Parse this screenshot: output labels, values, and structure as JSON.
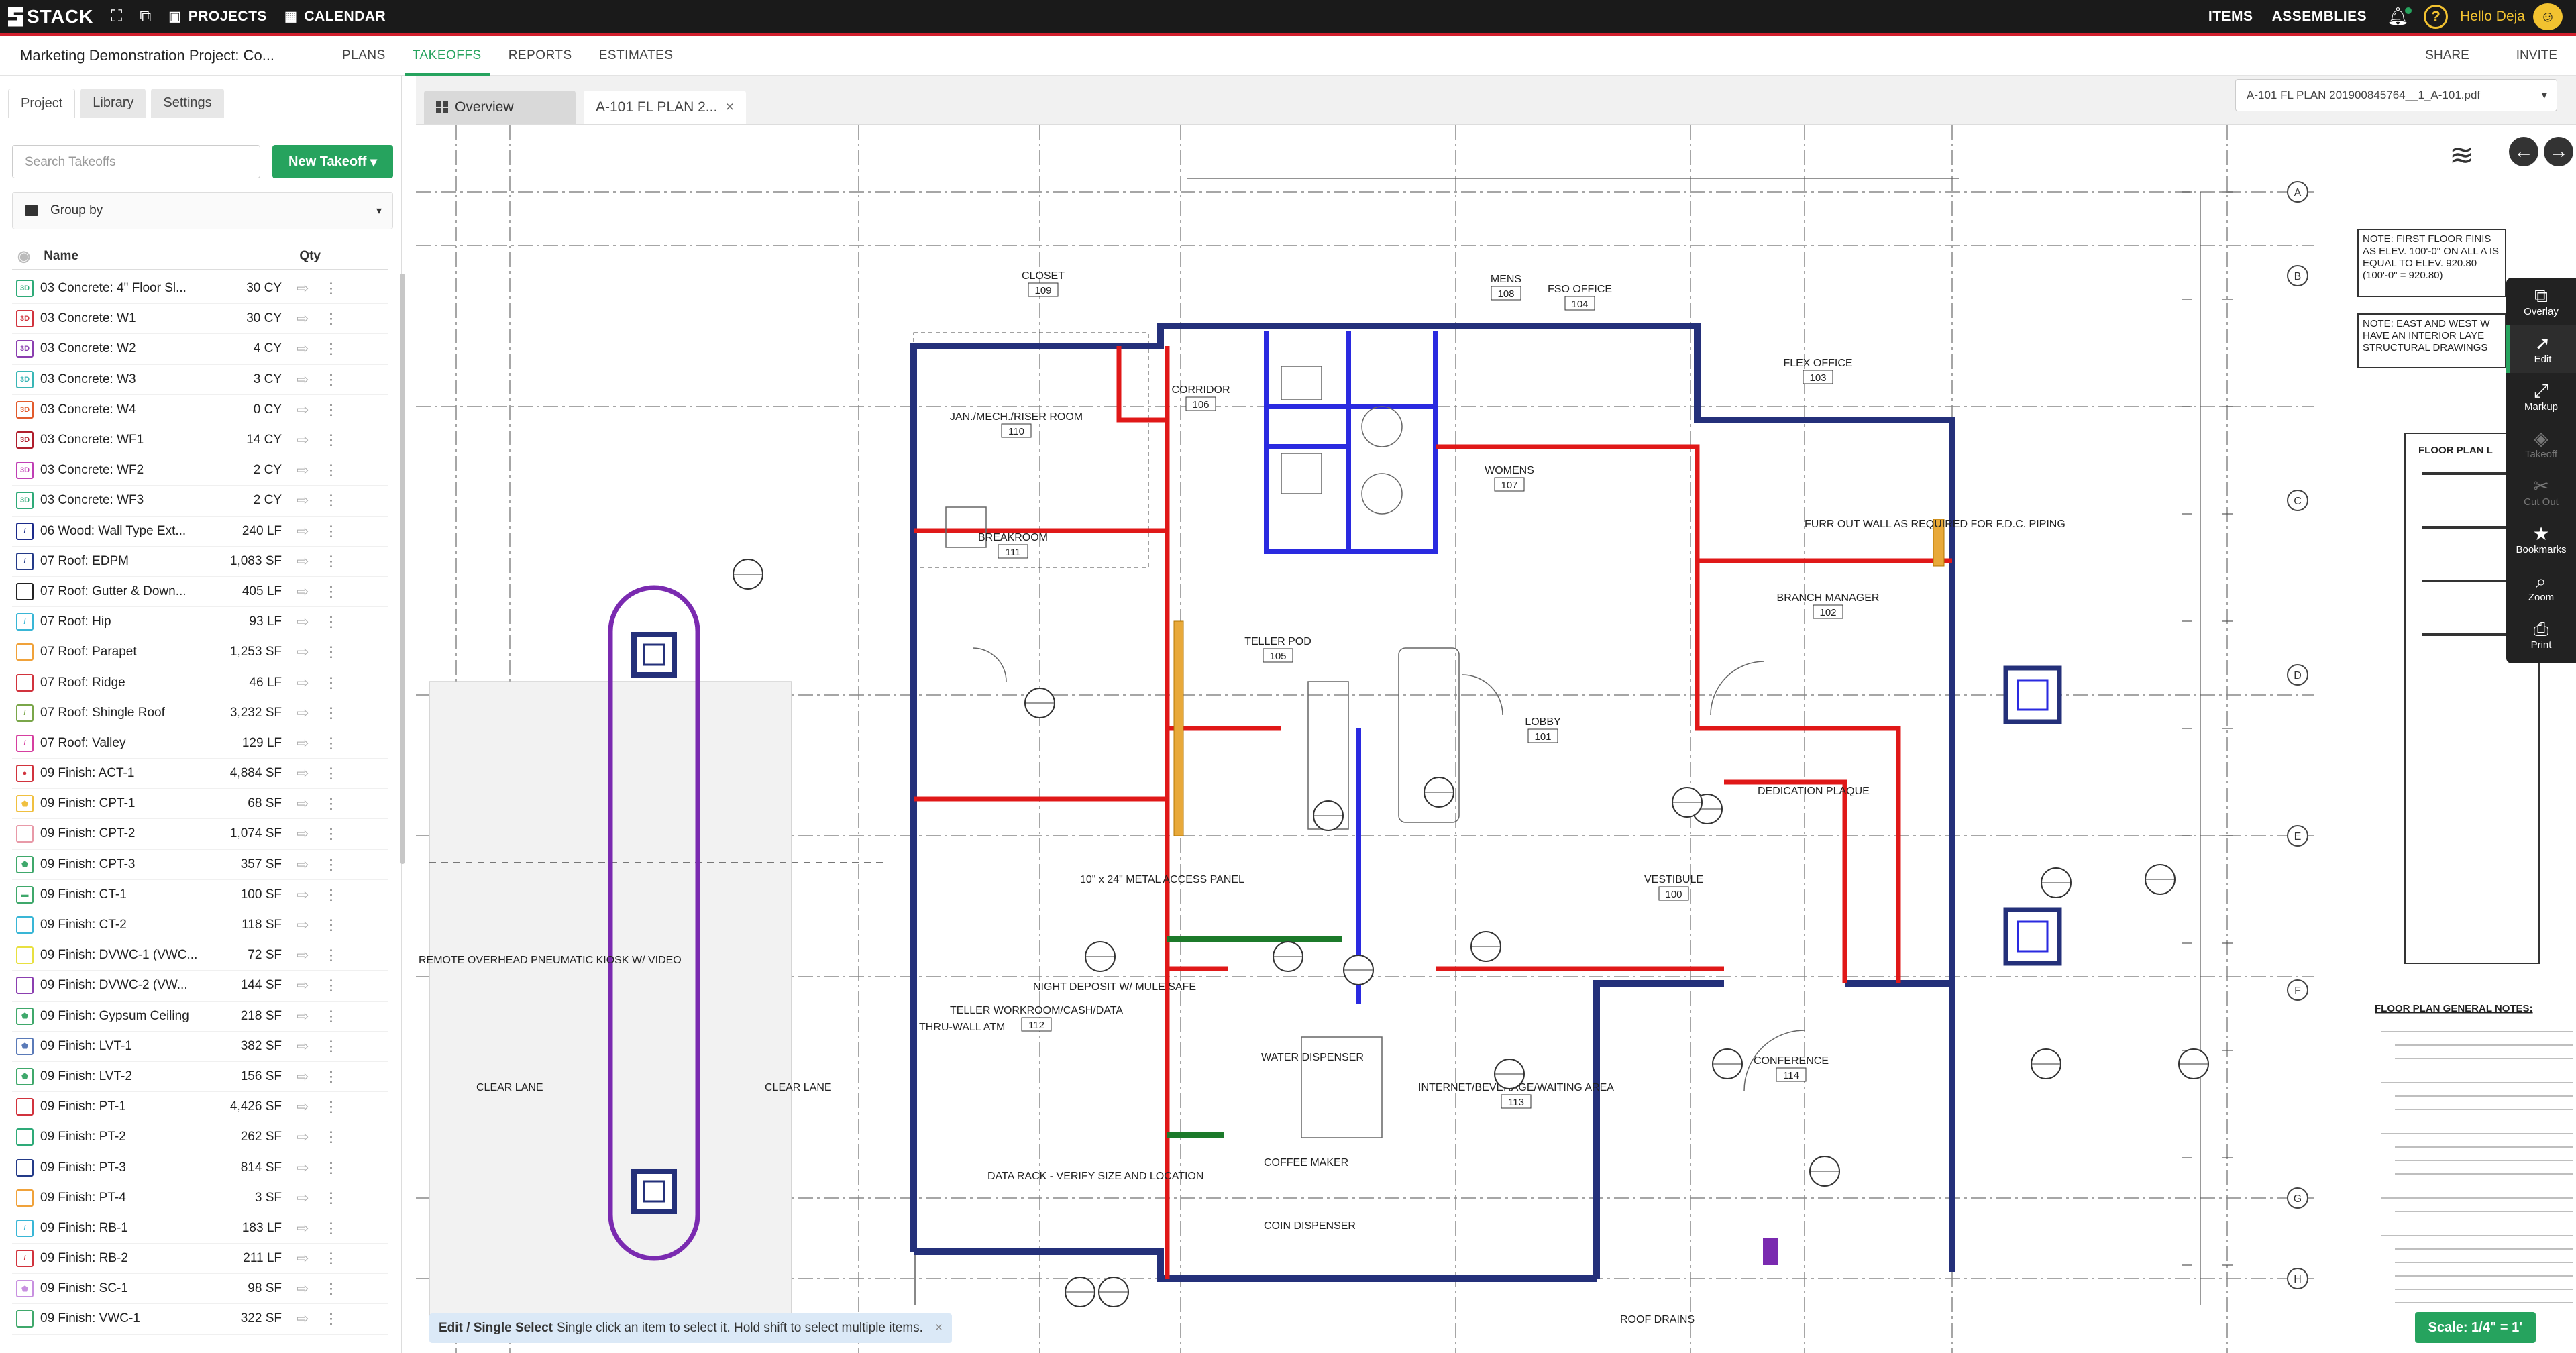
{
  "app": {
    "logo_text": "STACK",
    "nav_projects": "PROJECTS",
    "nav_calendar": "CALENDAR",
    "nav_items": "ITEMS",
    "nav_assemblies": "ASSEMBLIES",
    "greeting": "Hello Deja"
  },
  "subnav": {
    "project_title": "Marketing Demonstration Project: Co...",
    "tabs": [
      "PLANS",
      "TAKEOFFS",
      "REPORTS",
      "ESTIMATES"
    ],
    "active_tab": "TAKEOFFS",
    "share": "SHARE",
    "invite": "INVITE"
  },
  "sidebar": {
    "tabs": [
      "Project",
      "Library",
      "Settings"
    ],
    "search_placeholder": "Search Takeoffs",
    "new_takeoff": "New Takeoff",
    "group_by": "Group by",
    "col_name": "Name",
    "col_qty": "Qty",
    "takeoffs": [
      {
        "name": "03 Concrete: 4\" Floor Sl...",
        "qty": "30 CY",
        "color": "#2eaa78",
        "glyph": "3D"
      },
      {
        "name": "03 Concrete: W1",
        "qty": "30 CY",
        "color": "#d1333d",
        "glyph": "3D"
      },
      {
        "name": "03 Concrete: W2",
        "qty": "4 CY",
        "color": "#8b3fb0",
        "glyph": "3D"
      },
      {
        "name": "03 Concrete: W3",
        "qty": "3 CY",
        "color": "#39b6b6",
        "glyph": "3D"
      },
      {
        "name": "03 Concrete: W4",
        "qty": "0 CY",
        "color": "#e25b2c",
        "glyph": "3D"
      },
      {
        "name": "03 Concrete: WF1",
        "qty": "14 CY",
        "color": "#b01e2c",
        "glyph": "3D"
      },
      {
        "name": "03 Concrete: WF2",
        "qty": "2 CY",
        "color": "#c03fb5",
        "glyph": "3D"
      },
      {
        "name": "03 Concrete: WF3",
        "qty": "2 CY",
        "color": "#2eaa78",
        "glyph": "3D"
      },
      {
        "name": "06 Wood: Wall Type Ext...",
        "qty": "240 LF",
        "color": "#1b2a8a",
        "glyph": "/"
      },
      {
        "name": "07 Roof: EDPM",
        "qty": "1,083 SF",
        "color": "#233a88",
        "glyph": "/"
      },
      {
        "name": "07 Roof: Gutter & Down...",
        "qty": "405 LF",
        "color": "#222222",
        "glyph": ""
      },
      {
        "name": "07 Roof: Hip",
        "qty": "93 LF",
        "color": "#39b6d6",
        "glyph": "/"
      },
      {
        "name": "07 Roof: Parapet",
        "qty": "1,253 SF",
        "color": "#f0a23a",
        "glyph": ""
      },
      {
        "name": "07 Roof: Ridge",
        "qty": "46 LF",
        "color": "#d1333d",
        "glyph": ""
      },
      {
        "name": "07 Roof: Shingle Roof",
        "qty": "3,232 SF",
        "color": "#7aa64a",
        "glyph": "/"
      },
      {
        "name": "07 Roof: Valley",
        "qty": "129 LF",
        "color": "#d63fa0",
        "glyph": "/"
      },
      {
        "name": "09 Finish: ACT-1",
        "qty": "4,884 SF",
        "color": "#d1333d",
        "glyph": "●"
      },
      {
        "name": "09 Finish: CPT-1",
        "qty": "68 SF",
        "color": "#f0c040",
        "glyph": "⬟"
      },
      {
        "name": "09 Finish: CPT-2",
        "qty": "1,074 SF",
        "color": "#e89aa8",
        "glyph": ""
      },
      {
        "name": "09 Finish: CPT-3",
        "qty": "357 SF",
        "color": "#3fa86b",
        "glyph": "⬟"
      },
      {
        "name": "09 Finish: CT-1",
        "qty": "100 SF",
        "color": "#3fa86b",
        "glyph": "▬"
      },
      {
        "name": "09 Finish: CT-2",
        "qty": "118 SF",
        "color": "#39b6d6",
        "glyph": ""
      },
      {
        "name": "09 Finish: DVWC-1 (VWC...",
        "qty": "72 SF",
        "color": "#e8e040",
        "glyph": ""
      },
      {
        "name": "09 Finish: DVWC-2 (VW...",
        "qty": "144 SF",
        "color": "#8b3fb0",
        "glyph": ""
      },
      {
        "name": "09 Finish: Gypsum Ceiling",
        "qty": "218 SF",
        "color": "#3fa86b",
        "glyph": "⬟"
      },
      {
        "name": "09 Finish: LVT-1",
        "qty": "382 SF",
        "color": "#5a7ab8",
        "glyph": "⬟"
      },
      {
        "name": "09 Finish: LVT-2",
        "qty": "156 SF",
        "color": "#3fa86b",
        "glyph": "⬟"
      },
      {
        "name": "09 Finish: PT-1",
        "qty": "4,426 SF",
        "color": "#d1333d",
        "glyph": ""
      },
      {
        "name": "09 Finish: PT-2",
        "qty": "262 SF",
        "color": "#2eaa78",
        "glyph": ""
      },
      {
        "name": "09 Finish: PT-3",
        "qty": "814 SF",
        "color": "#233a88",
        "glyph": ""
      },
      {
        "name": "09 Finish: PT-4",
        "qty": "3 SF",
        "color": "#f0a23a",
        "glyph": ""
      },
      {
        "name": "09 Finish: RB-1",
        "qty": "183 LF",
        "color": "#39b6d6",
        "glyph": "/"
      },
      {
        "name": "09 Finish: RB-2",
        "qty": "211 LF",
        "color": "#d1333d",
        "glyph": "/"
      },
      {
        "name": "09 Finish: SC-1",
        "qty": "98 SF",
        "color": "#c890e0",
        "glyph": "⬟"
      },
      {
        "name": "09 Finish: VWC-1",
        "qty": "322 SF",
        "color": "#3fa86b",
        "glyph": ""
      }
    ]
  },
  "viewer": {
    "tab_overview": "Overview",
    "tab_sheet": "A-101 FL PLAN 2...",
    "sheet_select": "A-101 FL PLAN 201900845764__1_A-101.pdf",
    "status_mode": "Edit / Single Select",
    "status_hint": "Single click an item to select it. Hold shift to select multiple items.",
    "scale": "Scale: 1/4\" = 1'",
    "tools": [
      {
        "label": "Overlay",
        "icon": "overlay-icon",
        "glyph": "⧉",
        "enabled": true
      },
      {
        "label": "Edit",
        "icon": "cursor-icon",
        "glyph": "➚",
        "enabled": true
      },
      {
        "label": "Markup",
        "icon": "markup-icon",
        "glyph": "⤢",
        "enabled": true
      },
      {
        "label": "Takeoff",
        "icon": "takeoff-icon",
        "glyph": "◈",
        "enabled": false
      },
      {
        "label": "Cut Out",
        "icon": "cutout-icon",
        "glyph": "✂",
        "enabled": false
      },
      {
        "label": "Bookmarks",
        "icon": "star-icon",
        "glyph": "★",
        "enabled": true
      },
      {
        "label": "Zoom",
        "icon": "zoom-icon",
        "glyph": "⌕",
        "enabled": true
      },
      {
        "label": "Print",
        "icon": "print-icon",
        "glyph": "⎙",
        "enabled": true
      }
    ]
  },
  "plan": {
    "grid_right": [
      "A",
      "B",
      "C",
      "D",
      "E",
      "F",
      "G",
      "H"
    ],
    "rooms": [
      {
        "name": "CLOSET",
        "num": "109"
      },
      {
        "name": "CORRIDOR",
        "num": "106"
      },
      {
        "name": "JAN./MECH./RISER ROOM",
        "num": "110"
      },
      {
        "name": "MENS",
        "num": "108"
      },
      {
        "name": "FSO OFFICE",
        "num": "104"
      },
      {
        "name": "FLEX OFFICE",
        "num": "103"
      },
      {
        "name": "WOMENS",
        "num": "107"
      },
      {
        "name": "BREAKROOM",
        "num": "111"
      },
      {
        "name": "BRANCH MANAGER",
        "num": "102"
      },
      {
        "name": "TELLER POD",
        "num": "105"
      },
      {
        "name": "LOBBY",
        "num": "101"
      },
      {
        "name": "VESTIBULE",
        "num": "100"
      },
      {
        "name": "TELLER WORKROOM/CASH/DATA",
        "num": "112"
      },
      {
        "name": "INTERNET/BEVERAGE/WAITING AREA",
        "num": "113"
      },
      {
        "name": "CONFERENCE",
        "num": "114"
      }
    ],
    "notes": {
      "note1": "NOTE: FIRST FLOOR FINIS AS ELEV. 100'-0\" ON ALL A IS EQUAL TO ELEV. 920.80 (100'-0\" = 920.80)",
      "note2": "NOTE: EAST AND WEST W HAVE AN INTERIOR LAYE STRUCTURAL DRAWINGS",
      "legend_title": "FLOOR PLAN L",
      "general_title": "FLOOR PLAN GENERAL NOTES:"
    },
    "labels": {
      "kiosk": "REMOTE OVERHEAD PNEUMATIC KIOSK W/ VIDEO",
      "clear_lane": "CLEAR LANE",
      "thru_wall": "THRU-WALL ATM",
      "night_deposit": "NIGHT DEPOSIT W/ MULE SAFE",
      "furr_out": "FURR OUT WALL AS REQUIRED FOR F.D.C. PIPING",
      "dedication": "DEDICATION PLAQUE",
      "water": "WATER DISPENSER",
      "coffee": "COFFEE MAKER",
      "coin": "COIN DISPENSER",
      "data_rack": "DATA RACK - VERIFY SIZE AND LOCATION",
      "roof_drains": "ROOF DRAINS",
      "access_panel": "10\" x 24\" METAL ACCESS PANEL"
    }
  }
}
